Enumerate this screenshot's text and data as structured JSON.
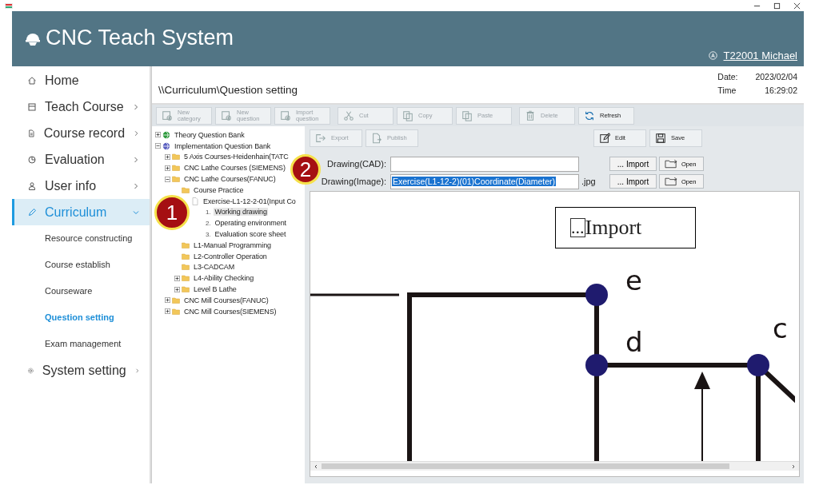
{
  "app": {
    "title": "CNC Teach System",
    "user": "T22001 Michael"
  },
  "nav": [
    {
      "label": "Home",
      "selected": false
    },
    {
      "label": "Teach Course",
      "selected": false,
      "expanded": false
    },
    {
      "label": "Course record",
      "selected": false,
      "expanded": false
    },
    {
      "label": "Evaluation",
      "selected": false,
      "expanded": false
    },
    {
      "label": "User info",
      "selected": false,
      "expanded": false
    },
    {
      "label": "Curriculum",
      "selected": true,
      "expanded": true,
      "children": [
        {
          "label": "Resource constructing",
          "selected": false
        },
        {
          "label": "Course establish",
          "selected": false
        },
        {
          "label": "Courseware",
          "selected": false
        },
        {
          "label": "Question setting",
          "selected": true
        },
        {
          "label": "Exam management",
          "selected": false
        }
      ]
    },
    {
      "label": "System setting",
      "selected": false,
      "expanded": false
    }
  ],
  "breadcrumb": "\\\\Curriculum\\Question setting",
  "date": {
    "date_label": "Date:",
    "date": "2023/02/04",
    "time_label": "Time",
    "time": "16:29:02"
  },
  "toolbar": [
    {
      "label": "New\ncategory",
      "disabled": true
    },
    {
      "label": "New\nquestion",
      "disabled": true
    },
    {
      "label": "Import\nquestion",
      "disabled": true
    },
    {
      "label": "Cut",
      "disabled": true
    },
    {
      "label": "Copy",
      "disabled": true
    },
    {
      "label": "Paste",
      "disabled": true
    },
    {
      "label": "Delete",
      "disabled": true
    },
    {
      "label": "Refresh",
      "disabled": false
    }
  ],
  "tree": [
    {
      "label": "Theory Question Bank",
      "kind": "bank",
      "expanded": false,
      "selected": false
    },
    {
      "label": "Implementation Question Bank",
      "kind": "bank",
      "expanded": true,
      "selected": false,
      "children": [
        {
          "label": "5 Axis Courses-Heidenhain(TATC",
          "kind": "folder",
          "expanded": false,
          "selected": false
        },
        {
          "label": "CNC Lathe Courses (SIEMENS)",
          "kind": "folder",
          "expanded": false,
          "selected": false
        },
        {
          "label": "CNC Lathe Courses(FANUC)",
          "kind": "folder",
          "expanded": true,
          "selected": false,
          "children": [
            {
              "label": "Course Practice",
              "kind": "folder",
              "selected": false,
              "children": [
                {
                  "label": "Exercise-L1-12-2-01(Input Co",
                  "kind": "doc",
                  "selected": false,
                  "children": [
                    {
                      "number": "1.",
                      "label": "Working drawing",
                      "kind": "step",
                      "selected": true
                    },
                    {
                      "number": "2.",
                      "label": "Operating environment",
                      "kind": "step",
                      "selected": false
                    },
                    {
                      "number": "3.",
                      "label": "Evaluation score sheet",
                      "kind": "step",
                      "selected": false
                    }
                  ]
                }
              ]
            },
            {
              "label": "L1-Manual Programming",
              "kind": "folder",
              "selected": false
            },
            {
              "label": "L2-Controller Operation",
              "kind": "folder",
              "selected": false
            },
            {
              "label": "L3-CADCAM",
              "kind": "folder",
              "selected": false
            },
            {
              "label": "L4-Ability Checking",
              "kind": "folder",
              "expanded": false,
              "selected": false
            },
            {
              "label": "Level B Lathe",
              "kind": "folder",
              "expanded": false,
              "selected": false
            }
          ]
        },
        {
          "label": "CNC Mill Courses(FANUC)",
          "kind": "folder",
          "expanded": false,
          "selected": false
        },
        {
          "label": "CNC Mill Courses(SIEMENS)",
          "kind": "folder",
          "expanded": false,
          "selected": false
        }
      ]
    }
  ],
  "toolbar2": [
    {
      "label": "Export",
      "disabled": true
    },
    {
      "label": "Publish",
      "disabled": true
    },
    {
      "label": "Edit",
      "disabled": false
    },
    {
      "label": "Save",
      "disabled": false
    }
  ],
  "fields": [
    {
      "label": "Drawing(CAD):",
      "import": "... Import",
      "open": "Open"
    },
    {
      "label": "Drawing(Image):",
      "value": "Exercise(L1-12-2)(01)Coordinate(Diameter)",
      "selected": true,
      "suffix": ".jpg",
      "import": "... Import",
      "open": "Open"
    }
  ],
  "preview": {
    "labels": [
      "e",
      "d",
      "c"
    ],
    "note_mark": "...",
    "note": "Import"
  },
  "callouts": [
    {
      "label": "1"
    },
    {
      "label": "2"
    }
  ]
}
